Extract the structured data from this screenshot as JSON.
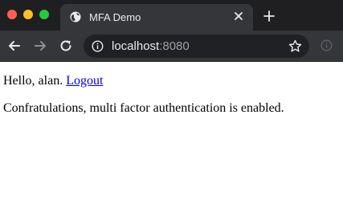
{
  "browser": {
    "tab_title": "MFA Demo",
    "url_host": "localhost",
    "url_port": ":8080",
    "icons": {
      "window_controls": [
        "close-dot",
        "minimize-dot",
        "maximize-dot"
      ],
      "tab_favicon": "globe-icon",
      "tab_close": "close-icon",
      "new_tab": "plus-icon",
      "back": "arrow-left-icon",
      "forward": "arrow-right-icon",
      "reload": "reload-icon",
      "site_info": "info-icon",
      "bookmark": "star-icon",
      "extension": "info-circle-icon"
    },
    "colors": {
      "close": "#fe5f57",
      "minimize": "#febc2e",
      "maximize": "#28c840",
      "frame": "#1f1f21",
      "toolbar": "#35363a",
      "omnibox": "#202124"
    }
  },
  "page": {
    "greeting": "Hello, alan.",
    "logout_label": "Logout",
    "message": "Confratulations, multi factor authentication is enabled.",
    "link_color": "#0000ee"
  }
}
